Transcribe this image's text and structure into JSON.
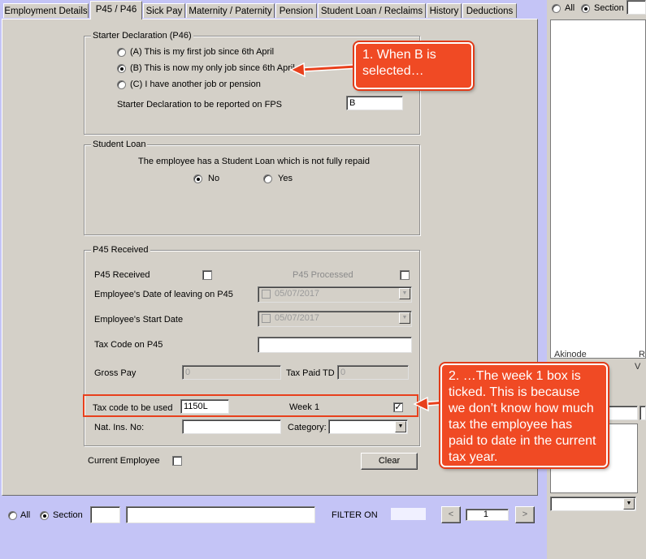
{
  "tabs": [
    "Employment Details",
    "P45 / P46",
    "Sick Pay",
    "Maternity / Paternity",
    "Pension",
    "Student Loan / Reclaims",
    "History",
    "Deductions"
  ],
  "active_tab": "P45 / P46",
  "starter": {
    "title": "Starter Declaration (P46)",
    "options": [
      "(A) This is my first job since 6th April",
      "(B) This is now my only job since 6th April",
      "(C) I have another job or pension"
    ],
    "selected": "B",
    "fps_label": "Starter Declaration to be reported on FPS",
    "fps_value": "B"
  },
  "student_loan": {
    "title": "Student Loan",
    "question": "The employee has a Student Loan which is not fully repaid",
    "no_label": "No",
    "yes_label": "Yes",
    "selected": "No"
  },
  "p45": {
    "title": "P45 Received",
    "received_label": "P45 Received",
    "processed_label": "P45 Processed",
    "leaving_label": "Employee's Date of leaving on P45",
    "leaving_value": "05/07/2017",
    "start_label": "Employee's Start Date",
    "start_value": "05/07/2017",
    "taxcode_label": "Tax Code on P45",
    "taxcode_value": "",
    "gross_label": "Gross Pay",
    "gross_value": "0",
    "taxpaid_label": "Tax Paid TD",
    "taxpaid_value": "0",
    "taxused_label": "Tax code to be used",
    "taxused_value": "1150L",
    "week1_label": "Week 1",
    "week1_checked": true,
    "ni_label": "Nat. Ins. No:",
    "ni_value": "",
    "category_label": "Category:",
    "category_value": ""
  },
  "current_employee_label": "Current Employee",
  "clear_label": "Clear",
  "footer": {
    "all_label": "All",
    "section_label": "Section",
    "filter_label": "FILTER ON",
    "page_value": "1",
    "prev": "<",
    "next": ">"
  },
  "right_pane": {
    "all_label": "All",
    "section_label": "Section",
    "list_bottom_text": "Akinode",
    "list_bottom_right": "R",
    "list_bottom_right2": "V"
  },
  "callouts": {
    "one": "1. When B is selected…",
    "two": "2. …The week 1 box is ticked. This is because we don’t know how much tax the employee has paid to date in the current tax year."
  },
  "colors": {
    "window_bg": "#d4d0c8",
    "desktop_bg": "#c4c4f6",
    "callout": "#f04a24"
  }
}
